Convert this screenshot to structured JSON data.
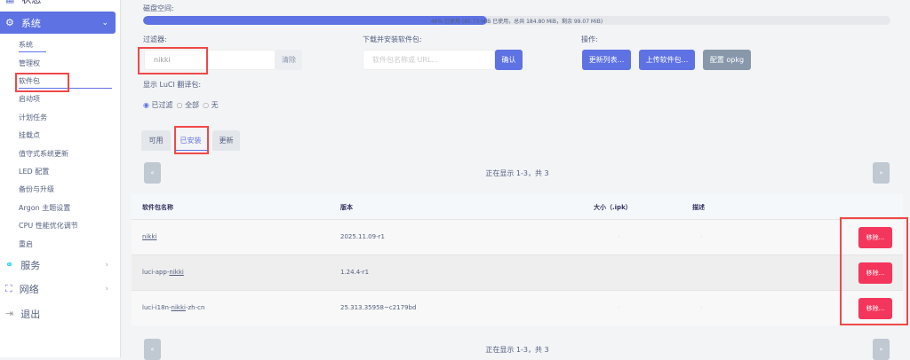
{
  "sidebar": {
    "status": "状态",
    "system": "系统",
    "sub": [
      "系统",
      "管理权",
      "软件包",
      "启动项",
      "计划任务",
      "挂载点",
      "值守式系统更新",
      "LED 配置",
      "备份与升级",
      "Argon 主题设置",
      "CPU 性能优化调节",
      "重启"
    ],
    "services": "服务",
    "network": "网络",
    "logout": "退出"
  },
  "disk": {
    "label": "磁盘空间:",
    "percent": 46,
    "text": "46% 已使用 (85.73 MiB 已使用，总共 184.80 MiB，剩余 99.07 MiB)"
  },
  "filter": {
    "label": "过滤器:",
    "value": "nikki",
    "clear": "清除"
  },
  "download": {
    "label": "下载并安装软件包:",
    "placeholder": "软件包名称或 URL...",
    "confirm": "确认"
  },
  "actions": {
    "label": "操作:",
    "update": "更新列表...",
    "upload": "上传软件包...",
    "config": "配置 opkg"
  },
  "translations": {
    "label": "显示 LuCI 翻译包:",
    "options": [
      "已过滤",
      "全部",
      "无"
    ],
    "selected": "已过滤"
  },
  "tabs": [
    "可用",
    "已安装",
    "更新"
  ],
  "active_tab": "已安装",
  "pager": {
    "prev": "«",
    "next": "»",
    "text": "正在显示 1-3，共 3"
  },
  "table": {
    "headers": [
      "软件包名称",
      "版本",
      "大小（.ipk）",
      "描述"
    ],
    "rows": [
      {
        "name": "nikki",
        "version": "2025.11.09-r1",
        "size": "-",
        "desc": "-",
        "action": "移除..."
      },
      {
        "prefix": "luci-app-",
        "name": "nikki",
        "version": "1.24.4-r1",
        "size": "-",
        "desc": "-",
        "action": "移除..."
      },
      {
        "prefix": "luci-i18n-",
        "name": "nikki",
        "suffix": "-zh-cn",
        "version": "25.313.35958~c2179bd",
        "size": "-",
        "desc": "-",
        "action": "移除..."
      }
    ]
  },
  "colors": {
    "accent": "#5e72e4",
    "danger": "#f5365c",
    "annotation": "#f04848"
  }
}
